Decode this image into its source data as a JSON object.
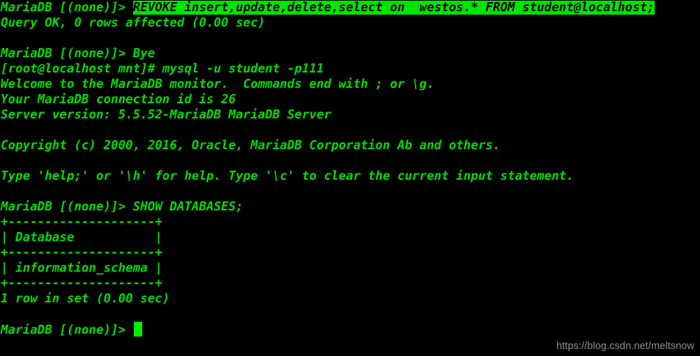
{
  "terminal": {
    "prompt_mysql": "MariaDB [(none)]> ",
    "prompt_shell": "[root@localhost mnt]# ",
    "colors": {
      "background": "#000000",
      "foreground": "#00dd00",
      "highlight_background": "#00e500",
      "highlight_foreground": "#000000",
      "cursor": "#00ee00",
      "watermark": "#8f8f8f"
    },
    "lines": [
      {
        "id": "line-revoke",
        "segments": [
          {
            "text": "MariaDB [(none)]> ",
            "highlight": false
          },
          {
            "text": "REVOKE insert,update,delete,select on  westos.* FROM student@localhost;",
            "highlight": true
          }
        ]
      },
      {
        "id": "line-query-ok",
        "segments": [
          {
            "text": "Query OK, 0 rows affected (0.00 sec)",
            "highlight": false
          }
        ]
      },
      {
        "id": "line-blank-1",
        "segments": [
          {
            "text": " ",
            "highlight": false
          }
        ]
      },
      {
        "id": "line-bye",
        "segments": [
          {
            "text": "MariaDB [(none)]> Bye",
            "highlight": false
          }
        ]
      },
      {
        "id": "line-mysql-login",
        "segments": [
          {
            "text": "[root@localhost mnt]# mysql -u student -p111",
            "highlight": false
          }
        ]
      },
      {
        "id": "line-welcome",
        "segments": [
          {
            "text": "Welcome to the MariaDB monitor.  Commands end with ; or \\g.",
            "highlight": false
          }
        ]
      },
      {
        "id": "line-connection-id",
        "segments": [
          {
            "text": "Your MariaDB connection id is 26",
            "highlight": false
          }
        ]
      },
      {
        "id": "line-server-version",
        "segments": [
          {
            "text": "Server version: 5.5.52-MariaDB MariaDB Server",
            "highlight": false
          }
        ]
      },
      {
        "id": "line-blank-2",
        "segments": [
          {
            "text": " ",
            "highlight": false
          }
        ]
      },
      {
        "id": "line-copyright",
        "segments": [
          {
            "text": "Copyright (c) 2000, 2016, Oracle, MariaDB Corporation Ab and others.",
            "highlight": false
          }
        ]
      },
      {
        "id": "line-blank-3",
        "segments": [
          {
            "text": " ",
            "highlight": false
          }
        ]
      },
      {
        "id": "line-help-hint",
        "segments": [
          {
            "text": "Type 'help;' or '\\h' for help. Type '\\c' to clear the current input statement.",
            "highlight": false
          }
        ]
      },
      {
        "id": "line-blank-4",
        "segments": [
          {
            "text": " ",
            "highlight": false
          }
        ]
      },
      {
        "id": "line-show-databases",
        "segments": [
          {
            "text": "MariaDB [(none)]> SHOW DATABASES;",
            "highlight": false
          }
        ]
      },
      {
        "id": "line-table-top-border",
        "segments": [
          {
            "text": "+--------------------+",
            "highlight": false
          }
        ]
      },
      {
        "id": "line-table-header",
        "segments": [
          {
            "text": "| Database           |",
            "highlight": false
          }
        ]
      },
      {
        "id": "line-table-mid-border",
        "segments": [
          {
            "text": "+--------------------+",
            "highlight": false
          }
        ]
      },
      {
        "id": "line-table-row-1",
        "segments": [
          {
            "text": "| information_schema |",
            "highlight": false
          }
        ]
      },
      {
        "id": "line-table-bottom-border",
        "segments": [
          {
            "text": "+--------------------+",
            "highlight": false
          }
        ]
      },
      {
        "id": "line-row-count",
        "segments": [
          {
            "text": "1 row in set (0.00 sec)",
            "highlight": false
          }
        ]
      },
      {
        "id": "line-blank-5",
        "segments": [
          {
            "text": " ",
            "highlight": false
          }
        ]
      },
      {
        "id": "line-final-prompt",
        "segments": [
          {
            "text": "MariaDB [(none)]> ",
            "highlight": false
          }
        ],
        "cursor": true
      }
    ]
  },
  "watermark": {
    "text": "https://blog.csdn.net/meltsnow"
  }
}
